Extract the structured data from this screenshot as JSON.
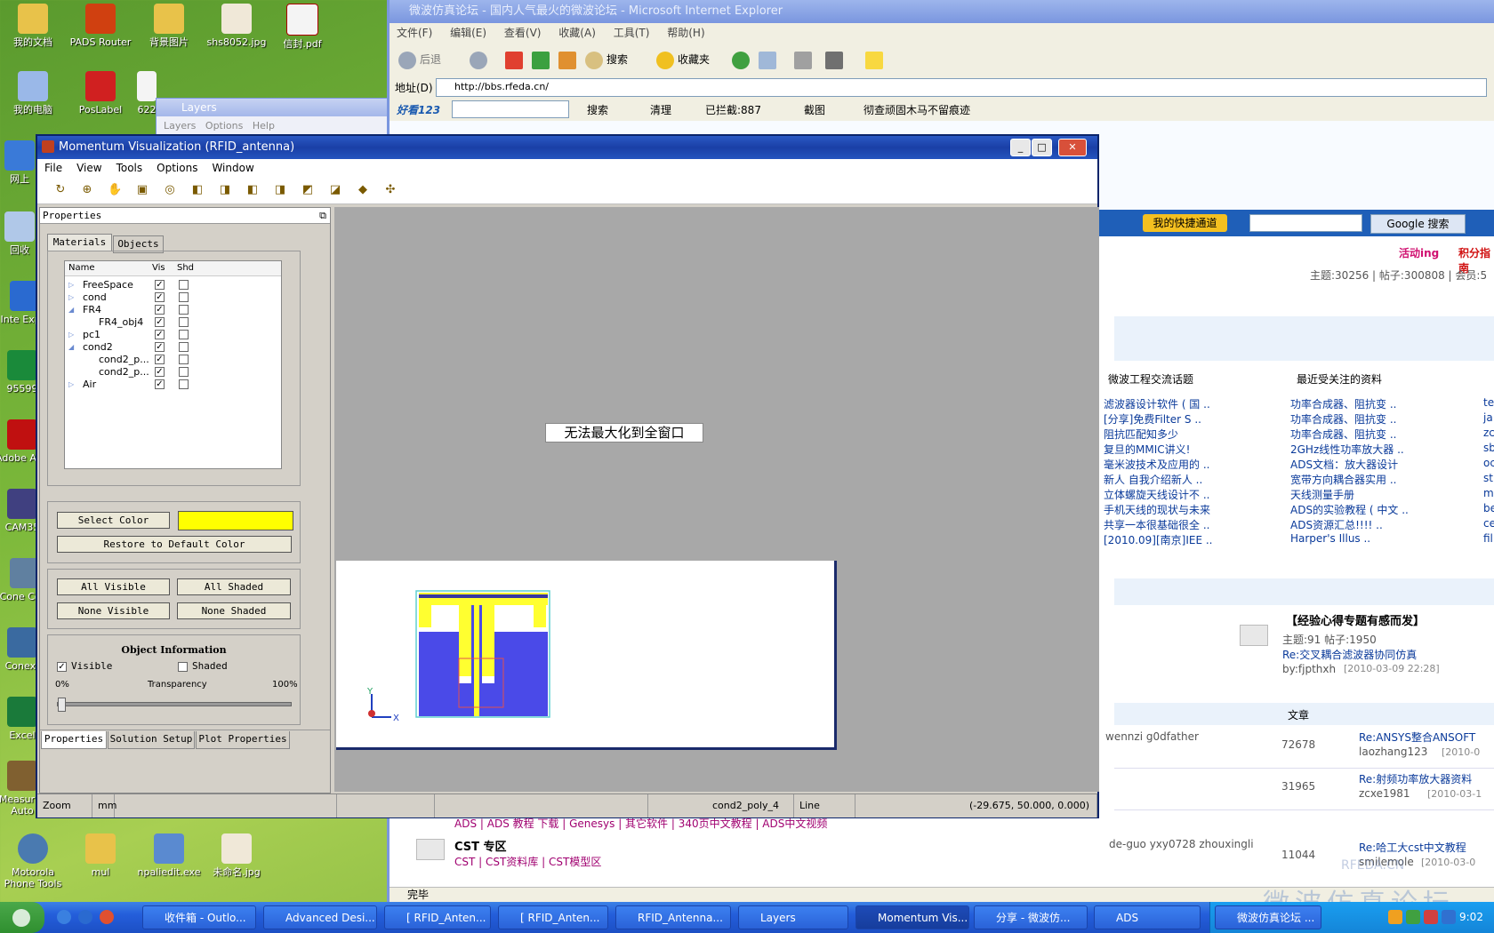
{
  "desktop": {
    "icons": [
      {
        "label": "我的文档"
      },
      {
        "label": "PADS Router"
      },
      {
        "label": "背景图片"
      },
      {
        "label": "shs8052.jpg"
      },
      {
        "label": "信封.pdf"
      },
      {
        "label": "我的电脑"
      },
      {
        "label": "PosLabel"
      },
      {
        "label": "622"
      },
      {
        "label": "网上"
      },
      {
        "label": "回收"
      },
      {
        "label": "Inte Explo"
      },
      {
        "label": "95599"
      },
      {
        "label": "Adobe A 5."
      },
      {
        "label": "CAM35"
      },
      {
        "label": "Cone Com"
      },
      {
        "label": "Conext"
      },
      {
        "label": "Excel"
      },
      {
        "label": "Measur & Auto"
      },
      {
        "label": "Motorola Phone Tools"
      },
      {
        "label": "mul"
      },
      {
        "label": "npaliedit.exe"
      },
      {
        "label": "未命名.jpg"
      }
    ]
  },
  "ie": {
    "title": "微波仿真论坛 - 国内人气最火的微波论坛 - Microsoft Internet Explorer",
    "menu": [
      "文件(F)",
      "编辑(E)",
      "查看(V)",
      "收藏(A)",
      "工具(T)",
      "帮助(H)"
    ],
    "toolbar": {
      "back": "后退",
      "search": "搜索",
      "favorites": "收藏夹"
    },
    "address_label": "地址(D)",
    "address": "http://bbs.rfeda.cn/",
    "bar2": {
      "logo": "好看123",
      "search": "搜索",
      "clean": "清理",
      "blocked": "已拦截:887",
      "screenshot": "截图",
      "trojan": "彻查顽固木马不留痕迹"
    },
    "status": "完毕",
    "page": {
      "quick_channel": "我的快捷通道",
      "google_search": "Google 搜索",
      "top_links": [
        "活动ing",
        "积分指南"
      ],
      "stats": "主题:30256 | 帖子:300808 | 会员:5",
      "col1_header": "微波工程交流话题",
      "col2_header": "最近受关注的资料",
      "col1": [
        "滤波器设计软件 ( 国 ..",
        "[分享]免费Filter S ..",
        "阻抗匹配知多少",
        "复旦的MMIC讲义!",
        "毫米波技术及应用的 ..",
        "新人 自我介绍新人 ..",
        "立体螺旋天线设计不 ..",
        "手机天线的现状与未来",
        "共享一本很基础很全 ..",
        "[2010.09][南京]IEE .."
      ],
      "col2": [
        "功率合成器、阻抗变 ..",
        "功率合成器、阻抗变 ..",
        "功率合成器、阻抗变 ..",
        "2GHz线性功率放大器 ..",
        "ADS文档：放大器设计",
        "宽带方向耦合器实用 ..",
        "天线测量手册",
        "ADS的实验教程 ( 中文 ..",
        "ADS资源汇总!!!! ..",
        "Harper's Illus .."
      ],
      "col3": [
        "te",
        "ja",
        "zc",
        "sb",
        "oc",
        "st",
        "m",
        "be",
        "ce",
        "fil"
      ],
      "feature_title": "【经验心得专题有感而发】",
      "feature_stats": "主题:91  帖子:1950",
      "feature_link": "Re:交叉耦合滤波器协同仿真",
      "feature_by": "by:fjpthxh",
      "feature_time": "[2010-03-09 22:28]",
      "article_header": "文章",
      "rows": [
        {
          "mods": "wennzi g0dfather",
          "count": "72678",
          "link": "Re:ANSYS整合ANSOFT",
          "user": "laozhang123",
          "time": "[2010-0"
        },
        {
          "mods": "",
          "count": "31965",
          "link": "Re:射频功率放大器资料",
          "user": "zcxe1981",
          "time": "[2010-03-1"
        },
        {
          "mods": "de-guo yxy0728 zhouxingli",
          "count": "11044",
          "link": "Re:哈工大cst中文教程",
          "user": "smilemole",
          "time": "[2010-03-0"
        }
      ],
      "ads_links": "ADS | ADS 教程 下载 | Genesys | 其它软件 | 340页中文教程 | ADS中文视频",
      "cst_title": "CST 专区",
      "cst_links": "CST | CST资料库 | CST模型区",
      "watermark": "微波仿真论坛",
      "watermark2": "RFEDA.CN"
    }
  },
  "layers": {
    "title": "Layers",
    "menu": [
      "Layers",
      "Options",
      "Help"
    ]
  },
  "momentum": {
    "title": "Momentum Visualization (RFID_antenna)",
    "menu": [
      "File",
      "View",
      "Tools",
      "Options",
      "Window"
    ],
    "panel_title": "Properties",
    "tabs": [
      "Materials",
      "Objects"
    ],
    "tree_headers": [
      "Name",
      "Vis",
      "Shd"
    ],
    "tree": [
      {
        "name": "FreeSpace",
        "indent": 0,
        "expander": "▷",
        "vis": true,
        "shd": false
      },
      {
        "name": "cond",
        "indent": 0,
        "expander": "▷",
        "vis": true,
        "shd": false
      },
      {
        "name": "FR4",
        "indent": 0,
        "expander": "◢",
        "vis": true,
        "shd": false
      },
      {
        "name": "FR4_obj4",
        "indent": 1,
        "expander": "",
        "vis": true,
        "shd": false
      },
      {
        "name": "pc1",
        "indent": 0,
        "expander": "▷",
        "vis": true,
        "shd": false
      },
      {
        "name": "cond2",
        "indent": 0,
        "expander": "◢",
        "vis": true,
        "shd": false
      },
      {
        "name": "cond2_p...",
        "indent": 1,
        "expander": "",
        "vis": true,
        "shd": false
      },
      {
        "name": "cond2_p...",
        "indent": 1,
        "expander": "",
        "vis": true,
        "shd": false
      },
      {
        "name": "Air",
        "indent": 0,
        "expander": "▷",
        "vis": true,
        "shd": false
      }
    ],
    "select_color": "Select Color",
    "color_swatch": "#ffff00",
    "restore_color": "Restore to Default Color",
    "all_visible": "All Visible",
    "all_shaded": "All Shaded",
    "none_visible": "None Visible",
    "none_shaded": "None Shaded",
    "object_info": "Object Information",
    "visible": "Visible",
    "shaded": "Shaded",
    "transparency": "Transparency",
    "t_min": "0%",
    "t_max": "100%",
    "transparency_value": 0,
    "bottom_tabs": [
      "Properties",
      "Solution Setup",
      "Plot Properties"
    ],
    "view_message": "无法最大化到全窗口",
    "axis_x": "X",
    "axis_y": "Y",
    "status": {
      "mode": "Zoom",
      "unit": "mm",
      "object": "cond2_poly_4",
      "type": "Line",
      "coords": "(-29.675,  50.000,  0.000)"
    }
  },
  "taskbar": {
    "tasks": [
      "收件箱 - Outlo...",
      "Advanced Desi...",
      "[ RFID_Anten...",
      "[ RFID_Anten...",
      "RFID_Antenna...",
      "Layers",
      "Momentum Vis...",
      "分享 - 微波仿...",
      "ADS",
      "微波仿真论坛 ..."
    ],
    "active": "Momentum Vis...",
    "clock": "9:02"
  }
}
